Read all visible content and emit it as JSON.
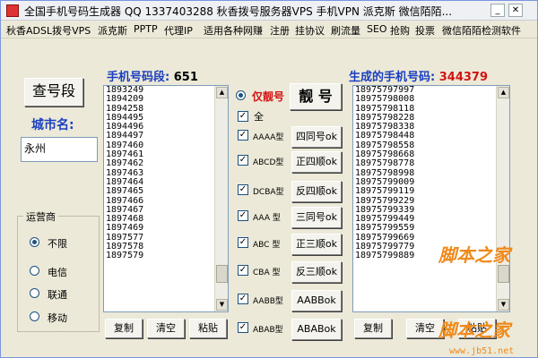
{
  "window": {
    "title": "全国手机号码生成器 QQ 1337403288 秋香拨号服务器VPS 手机VPN 派克斯 微信陌陌..."
  },
  "menu": [
    "秋香ADSL拨号VPS",
    "派克斯",
    "PPTP",
    "代理IP",
    "适用各种网赚",
    "注册",
    "挂协议",
    "刷流量",
    "SEO",
    "抢购",
    "投票",
    "微信陌陌检测软件"
  ],
  "left": {
    "query_button": "查号段",
    "city_label": "城市名:",
    "city_value": "永州",
    "segment_label": "手机号码段:",
    "segment_count": "651",
    "segments": [
      "1893249",
      "1894209",
      "1894258",
      "1894495",
      "1894496",
      "1894497",
      "1897460",
      "1897461",
      "1897462",
      "1897463",
      "1897464",
      "1897465",
      "1897466",
      "1897467",
      "1897468",
      "1897469",
      "1897577",
      "1897578",
      "1897579"
    ],
    "copy_button": "复制",
    "clear_button": "清空",
    "paste_button": "粘贴"
  },
  "carrier": {
    "title": "运营商",
    "options": [
      "不限",
      "电信",
      "联通",
      "移动"
    ],
    "selected": "不限"
  },
  "middle": {
    "pretty_radio_label": "仅靓号",
    "pretty_button": "靓 号",
    "all_label": "全",
    "types": [
      {
        "label": "AAAA型",
        "button": "四同号ok"
      },
      {
        "label": "ABCD型",
        "button": "正四顺ok"
      },
      {
        "label": "DCBA型",
        "button": "反四顺ok"
      },
      {
        "label": "AAA 型",
        "button": "三同号ok"
      },
      {
        "label": "ABC 型",
        "button": "正三顺ok"
      },
      {
        "label": "CBA 型",
        "button": "反三顺ok"
      },
      {
        "label": "AABB型",
        "button": "AABBok"
      },
      {
        "label": "ABAB型",
        "button": "ABABok"
      }
    ]
  },
  "right": {
    "generated_label": "生成的手机号码:",
    "generated_count": "344379",
    "numbers": [
      "18975797997",
      "18975798008",
      "18975798118",
      "18975798228",
      "18975798338",
      "18975798448",
      "18975798558",
      "18975798668",
      "18975798778",
      "18975798998",
      "18975799009",
      "18975799119",
      "18975799229",
      "18975799339",
      "18975799449",
      "18975799559",
      "18975799669",
      "18975799779",
      "18975799889"
    ],
    "copy_button": "复制",
    "clear_button": "清空",
    "paste_button": "粘贴"
  },
  "watermark": {
    "brand": "脚本之家",
    "url": "www.jb51.net"
  },
  "colors": {
    "label_blue": "#1a3fc0",
    "label_red": "#d21414",
    "watermark": "#f08a1a"
  }
}
